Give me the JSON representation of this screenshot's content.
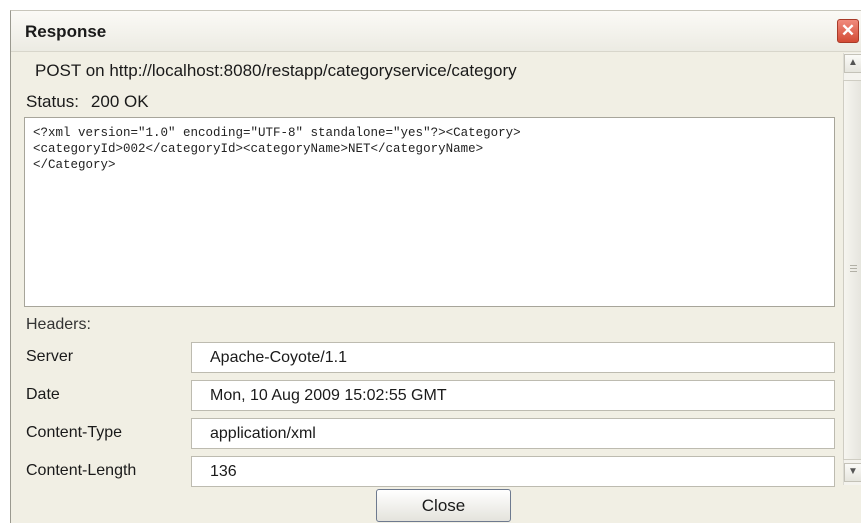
{
  "window": {
    "title": "Response",
    "close_glyph": "✕"
  },
  "request": {
    "line": "POST on http://localhost:8080/restapp/categoryservice/category"
  },
  "status": {
    "label": "Status:",
    "value": "200 OK"
  },
  "response_body": "<?xml version=\"1.0\" encoding=\"UTF-8\" standalone=\"yes\"?><Category>\n<categoryId>002</categoryId><categoryName>NET</categoryName>\n</Category>",
  "headers": {
    "label": "Headers:",
    "rows": [
      {
        "name": "Server",
        "value": "Apache-Coyote/1.1"
      },
      {
        "name": "Date",
        "value": "Mon, 10 Aug 2009 15:02:55 GMT"
      },
      {
        "name": "Content-Type",
        "value": "application/xml"
      },
      {
        "name": "Content-Length",
        "value": "136"
      }
    ]
  },
  "buttons": {
    "close": "Close"
  },
  "icons": {
    "close": "close-icon",
    "scroll_up": "chevron-up-icon",
    "scroll_down": "chevron-down-icon"
  },
  "colors": {
    "window_bg": "#f1efe4",
    "close_accent": "#d34b35"
  }
}
